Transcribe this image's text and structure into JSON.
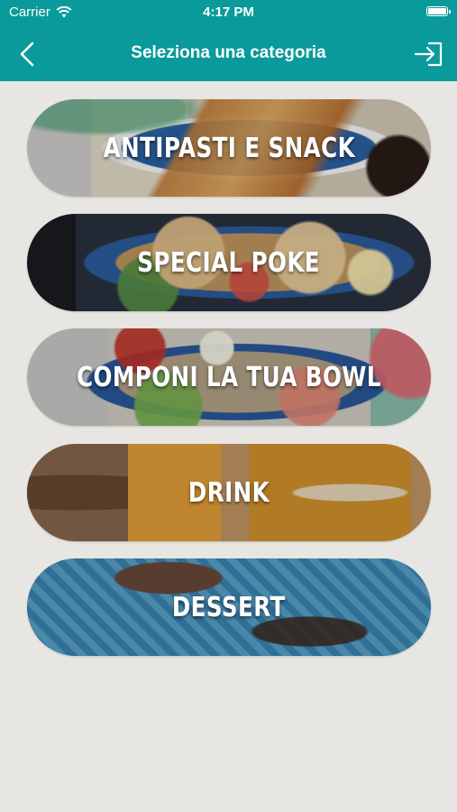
{
  "status_bar": {
    "carrier": "Carrier",
    "time": "4:17 PM"
  },
  "nav": {
    "title": "Seleziona una categoria"
  },
  "categories": [
    {
      "label": "ANTIPASTI E SNACK"
    },
    {
      "label": "SPECIAL POKE"
    },
    {
      "label": "COMPONI LA TUA BOWL"
    },
    {
      "label": "DRINK"
    },
    {
      "label": "DESSERT"
    }
  ],
  "colors": {
    "brand": "#0a9a9b",
    "background": "#e8e6e2"
  }
}
